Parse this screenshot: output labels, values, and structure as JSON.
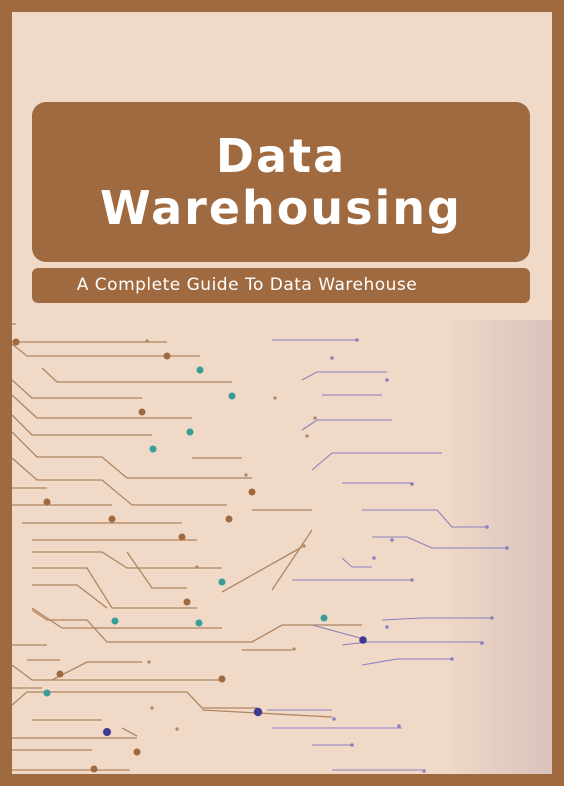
{
  "cover": {
    "title_line1": "Data",
    "title_line2": "Warehousing",
    "subtitle": "A Complete Guide To Data Warehouse"
  },
  "colors": {
    "frame": "#a06a40",
    "background": "#f0d9c7",
    "trace_brown": "#b08560",
    "trace_purple": "#8a80c0",
    "node_teal": "#3a9e98",
    "node_navy": "#3e3a90"
  }
}
